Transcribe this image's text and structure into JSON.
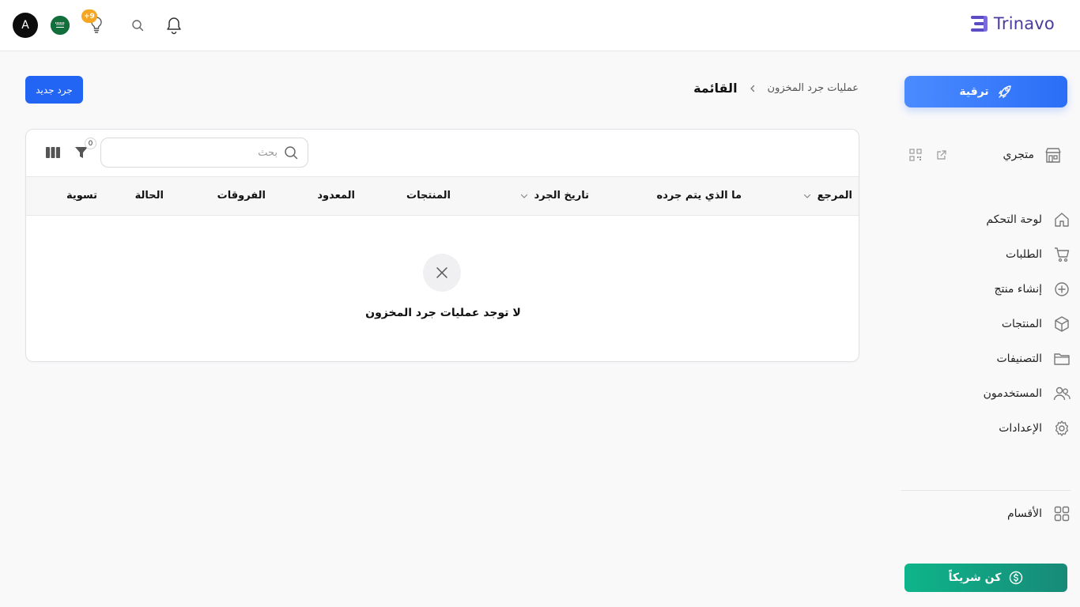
{
  "brand": {
    "name": "Trinavo",
    "color": "#4b3a9e"
  },
  "topbar": {
    "avatar_letter": "A",
    "tips_badge": "+9",
    "icons": [
      "bell-icon",
      "search-icon",
      "lightbulb-icon",
      "saudi-flag-icon"
    ]
  },
  "sidebar": {
    "upgrade_label": "ترقية",
    "store_label": "متجري",
    "items": [
      {
        "label": "لوحة التحكم",
        "icon": "home-icon"
      },
      {
        "label": "الطلبات",
        "icon": "cart-icon"
      },
      {
        "label": "إنشاء منتج",
        "icon": "plus-circle-icon"
      },
      {
        "label": "المنتجات",
        "icon": "box-icon"
      },
      {
        "label": "التصنيفات",
        "icon": "folder-icon"
      },
      {
        "label": "المستخدمون",
        "icon": "users-icon"
      },
      {
        "label": "الإعدادات",
        "icon": "gear-icon"
      }
    ],
    "sections_label": "الأقسام",
    "partner_label": "كن شريكاً",
    "colors": {
      "upgrade": "#2a6ef7",
      "partner": "#0eb58a"
    }
  },
  "page": {
    "breadcrumb_parent": "عمليات جرد المخزون",
    "breadcrumb_current": "القائمة",
    "new_button_label": "جرد جديد"
  },
  "table": {
    "search_placeholder": "بحث",
    "filter_count": "0",
    "columns": [
      {
        "label": "المرجع",
        "sortable": true
      },
      {
        "label": "ما الذي يتم جرده",
        "sortable": false
      },
      {
        "label": "تاريخ الجرد",
        "sortable": true
      },
      {
        "label": "المنتجات",
        "sortable": false
      },
      {
        "label": "المعدود",
        "sortable": false
      },
      {
        "label": "الفروقات",
        "sortable": false
      },
      {
        "label": "الحالة",
        "sortable": false
      },
      {
        "label": "تسوية",
        "sortable": false
      }
    ],
    "empty_message": "لا توجد عمليات جرد المخزون"
  }
}
